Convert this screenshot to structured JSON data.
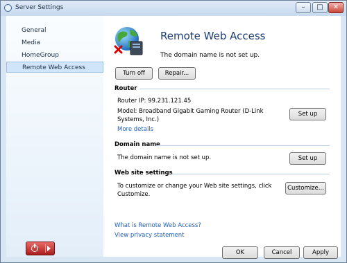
{
  "window": {
    "title": "Server Settings"
  },
  "sidebar": {
    "items": [
      "General",
      "Media",
      "HomeGroup",
      "Remote Web Access"
    ],
    "selected": "Remote Web Access"
  },
  "header": {
    "title": "Remote Web Access",
    "status": "The domain name is not set up."
  },
  "toolbar": {
    "turn_off": "Turn off",
    "repair": "Repair..."
  },
  "router": {
    "heading": "Router",
    "ip": "Router IP: 99.231.121.45",
    "model": "Model: Broadband Gigabit Gaming Router (D-Link Systems, Inc.)",
    "more_details": "More details",
    "setup": "Set up"
  },
  "domain": {
    "heading": "Domain name",
    "status": "The domain name is not set up.",
    "setup": "Set up"
  },
  "website": {
    "heading": "Web site settings",
    "description": "To customize or change your Web site settings, click Customize.",
    "customize": "Customize..."
  },
  "links": {
    "what_is": "What is Remote Web Access?",
    "privacy": "View privacy statement"
  },
  "footer": {
    "ok": "OK",
    "cancel": "Cancel",
    "apply": "Apply"
  }
}
